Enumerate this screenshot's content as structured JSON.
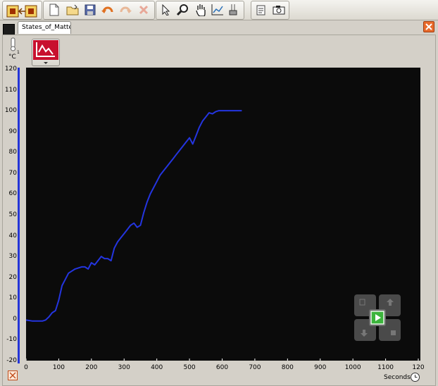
{
  "toolbar": {
    "icons": [
      "file-manager-icon",
      "new-file-icon",
      "open-file-icon",
      "save-icon",
      "undo-icon",
      "redo-icon",
      "delete-icon",
      "select-cursor-icon",
      "zoom-icon",
      "pan-hand-icon",
      "graph-options-icon",
      "sensor-setup-icon",
      "notes-icon",
      "camera-icon"
    ]
  },
  "tab": {
    "label": "States_of_Matte"
  },
  "sensor": {
    "unit": "°C",
    "number": "1"
  },
  "y_tick_labels": [
    "120",
    "110",
    "100",
    "90",
    "80",
    "70",
    "60",
    "50",
    "40",
    "30",
    "20",
    "10",
    "0",
    "-10",
    "-20"
  ],
  "x_tick_labels": [
    "0",
    "100",
    "200",
    "300",
    "400",
    "500",
    "600",
    "700",
    "800",
    "900",
    "1000",
    "1100",
    "120"
  ],
  "x_unit": "Seconds",
  "colors": {
    "plot_background": "#0b0b0b",
    "series": "#2435e0",
    "panel": "#d4d0c8"
  },
  "chart_data": {
    "type": "line",
    "xlabel": "Seconds",
    "ylabel": "°C",
    "xlim": [
      0,
      1200
    ],
    "ylim": [
      -20,
      120
    ],
    "grid": false,
    "series": [
      {
        "x": [
          0,
          20,
          50,
          60,
          70,
          80,
          90,
          100,
          110,
          120,
          130,
          140,
          150,
          160,
          170,
          180,
          190,
          200,
          210,
          220,
          230,
          240,
          250,
          260,
          270,
          280,
          290,
          300,
          310,
          320,
          330,
          340,
          350,
          360,
          370,
          380,
          390,
          400,
          410,
          420,
          430,
          440,
          450,
          460,
          470,
          480,
          490,
          500,
          510,
          520,
          530,
          540,
          550,
          560,
          570,
          580,
          590,
          600,
          620,
          660
        ],
        "y": [
          -0.5,
          -1,
          -1,
          -0.5,
          1,
          3,
          4,
          9,
          16,
          19,
          22,
          23,
          24,
          24.5,
          25,
          25,
          24,
          27,
          26,
          28,
          30,
          29,
          29,
          28,
          34,
          37,
          39,
          41,
          43,
          45,
          46,
          44,
          45,
          51,
          56,
          60,
          63,
          66,
          69,
          71,
          73,
          75,
          77,
          79,
          81,
          83,
          85,
          87,
          84,
          88,
          92,
          95,
          97,
          99,
          98.5,
          99.5,
          100,
          100,
          100,
          100
        ]
      }
    ]
  }
}
